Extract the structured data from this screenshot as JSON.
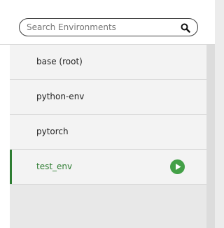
{
  "search": {
    "placeholder": "Search Environments",
    "value": ""
  },
  "environments": [
    {
      "label": "base (root)",
      "active": false
    },
    {
      "label": "python-env",
      "active": false
    },
    {
      "label": "pytorch",
      "active": false
    },
    {
      "label": "test_env",
      "active": true
    }
  ],
  "icons": {
    "search": "search-icon",
    "play": "play-icon"
  },
  "colors": {
    "active_accent": "#2e7d32",
    "play_button": "#43a047"
  }
}
